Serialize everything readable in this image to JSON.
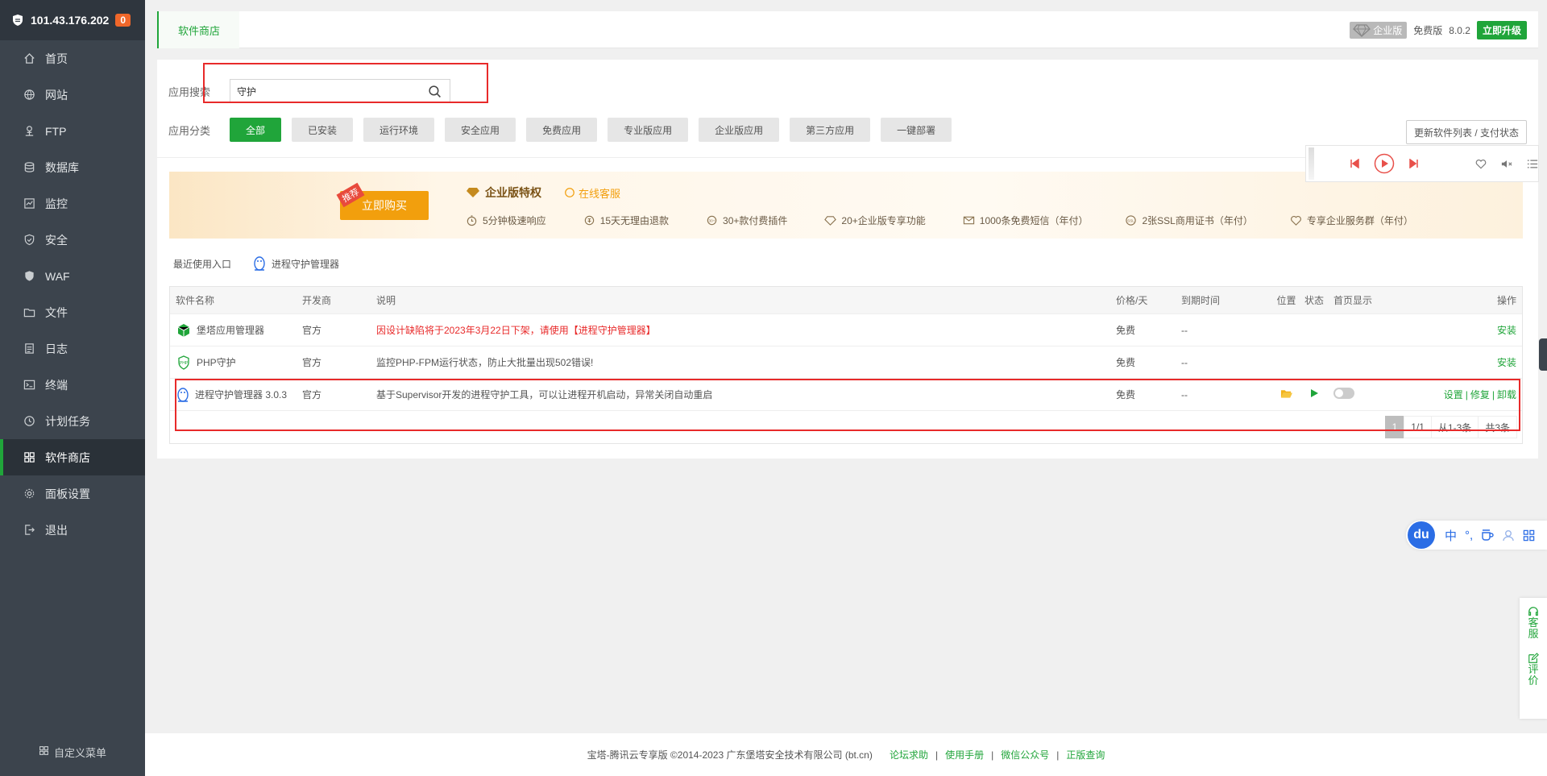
{
  "server": {
    "ip": "101.43.176.202",
    "badge": "0"
  },
  "sidebar": {
    "items": [
      {
        "label": "首页",
        "icon": "home-icon"
      },
      {
        "label": "网站",
        "icon": "globe-icon"
      },
      {
        "label": "FTP",
        "icon": "ftp-icon"
      },
      {
        "label": "数据库",
        "icon": "database-icon"
      },
      {
        "label": "监控",
        "icon": "monitor-icon"
      },
      {
        "label": "安全",
        "icon": "shield-icon"
      },
      {
        "label": "WAF",
        "icon": "waf-icon"
      },
      {
        "label": "文件",
        "icon": "folder-icon"
      },
      {
        "label": "日志",
        "icon": "log-icon"
      },
      {
        "label": "终端",
        "icon": "terminal-icon"
      },
      {
        "label": "计划任务",
        "icon": "clock-icon"
      },
      {
        "label": "软件商店",
        "icon": "grid-icon",
        "active": true
      },
      {
        "label": "面板设置",
        "icon": "gear-icon"
      },
      {
        "label": "退出",
        "icon": "logout-icon"
      }
    ],
    "custom_menu": "自定义菜单"
  },
  "topbar": {
    "tab": "软件商店",
    "edition": "企业版",
    "free": "免费版",
    "version": "8.0.2",
    "upgrade": "立即升级"
  },
  "search": {
    "label": "应用搜索",
    "value": "守护"
  },
  "categories": {
    "label": "应用分类",
    "items": [
      "全部",
      "已安装",
      "运行环境",
      "安全应用",
      "免费应用",
      "专业版应用",
      "企业版应用",
      "第三方应用",
      "一键部署"
    ]
  },
  "update_btn": "更新软件列表 / 支付状态",
  "banner": {
    "tag": "推荐",
    "buy": "立即购买",
    "title": "企业版特权",
    "service": "在线客服",
    "features": [
      "5分钟极速响应",
      "15天无理由退款",
      "30+款付费插件",
      "20+企业版专享功能",
      "1000条免费短信（年付）",
      "2张SSL商用证书（年付）",
      "专享企业服务群（年付）"
    ]
  },
  "recent": {
    "label": "最近使用入口",
    "item": "进程守护管理器"
  },
  "table": {
    "headers": [
      "软件名称",
      "开发商",
      "说明",
      "价格/天",
      "到期时间",
      "位置",
      "状态",
      "首页显示",
      "操作"
    ],
    "rows": [
      {
        "name": "堡塔应用管理器",
        "dev": "官方",
        "desc": "因设计缺陷将于2023年3月22日下架，请使用【进程守护管理器】",
        "price": "免费",
        "expire": "--",
        "op": "安装"
      },
      {
        "name": "PHP守护",
        "dev": "官方",
        "desc": "监控PHP-FPM运行状态，防止大批量出现502错误!",
        "price": "免费",
        "expire": "--",
        "op": "安装"
      },
      {
        "name": "进程守护管理器 3.0.3",
        "dev": "官方",
        "desc": "基于Supervisor开发的进程守护工具，可以让进程开机启动，异常关闭自动重启",
        "price": "免费",
        "expire": "--",
        "ops": [
          "设置",
          "修复",
          "卸载"
        ]
      }
    ]
  },
  "pager": {
    "current": "1",
    "pages": "1/1",
    "range": "从1-3条",
    "total": "共3条"
  },
  "ime": {
    "logo": "du",
    "mode": "中",
    "punct": "°,"
  },
  "side_help": {
    "service": "客服",
    "review": "评价"
  },
  "footer": {
    "copyright": "宝塔-腾讯云专享版 ©2014-2023 广东堡塔安全技术有限公司 (bt.cn)",
    "links": [
      "论坛求助",
      "使用手册",
      "微信公众号",
      "正版查询"
    ]
  },
  "colors": {
    "accent": "#20a53a",
    "sidebar": "#3c444d",
    "warn": "#e82a2a",
    "banner_orange": "#f29f0d"
  }
}
